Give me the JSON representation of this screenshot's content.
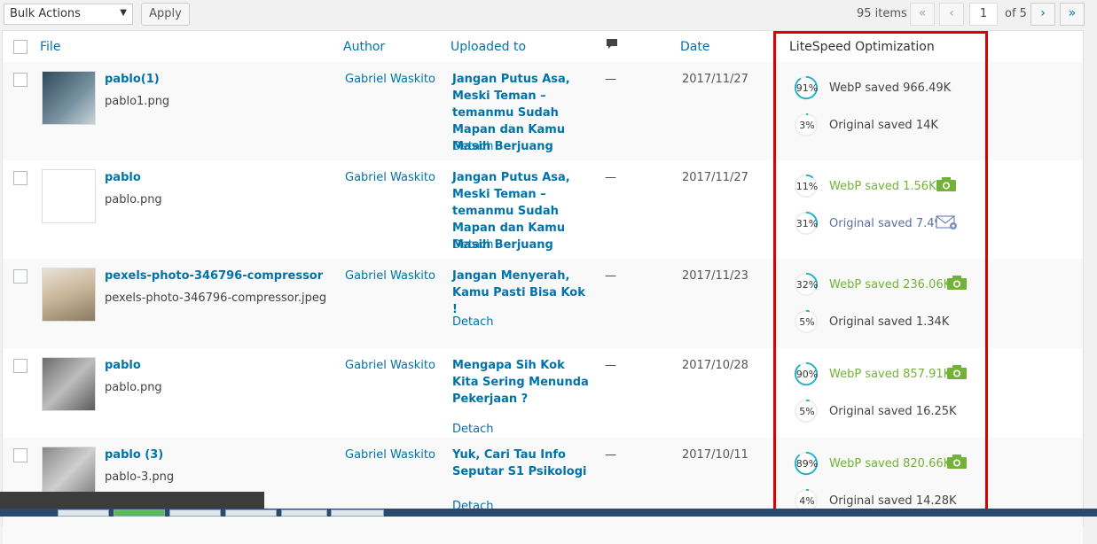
{
  "toolbar": {
    "bulk_actions": "Bulk Actions",
    "apply": "Apply",
    "items_count": "95 items",
    "first": "«",
    "prev": "‹",
    "current_page": "1",
    "of_pages": "of 5",
    "next": "›",
    "last": "»"
  },
  "columns": {
    "file": "File",
    "author": "Author",
    "uploaded_to": "Uploaded to",
    "comments_icon": "comment-icon",
    "date": "Date",
    "litespeed": "LiteSpeed Optimization"
  },
  "rows": [
    {
      "title": "pablo(1)",
      "filename": "pablo1.png",
      "author": "Gabriel Waskito",
      "uploaded_to": "Jangan Putus Asa, Meski Teman – temanmu Sudah Mapan dan Kamu Masih Berjuang",
      "detach": "Detach",
      "comments": "—",
      "date": "2017/11/27",
      "webp_pct": "91%",
      "webp": "WebP saved 966.49K",
      "webp_fill": 0.91,
      "webp_green": false,
      "orig_pct": "3%",
      "orig": "Original saved 14K",
      "orig_fill": 0.03,
      "orig_icon": ""
    },
    {
      "title": "pablo",
      "filename": "pablo.png",
      "author": "Gabriel Waskito",
      "uploaded_to": "Jangan Putus Asa, Meski Teman – temanmu Sudah Mapan dan Kamu Masih Berjuang",
      "detach": "Detach",
      "comments": "—",
      "date": "2017/11/27",
      "webp_pct": "11%",
      "webp": "WebP saved 1.56K",
      "webp_fill": 0.11,
      "webp_green": true,
      "orig_pct": "31%",
      "orig": "Original saved 7.49K",
      "orig_fill": 0.31,
      "orig_icon": "mail-settings-icon"
    },
    {
      "title": "pexels-photo-346796-compressor",
      "filename": "pexels-photo-346796-compressor.jpeg",
      "author": "Gabriel Waskito",
      "uploaded_to": "Jangan Menyerah, Kamu Pasti Bisa Kok !",
      "detach": "Detach",
      "comments": "—",
      "date": "2017/11/23",
      "webp_pct": "32%",
      "webp": "WebP saved 236.06K",
      "webp_fill": 0.32,
      "webp_green": true,
      "orig_pct": "5%",
      "orig": "Original saved 1.34K",
      "orig_fill": 0.05,
      "orig_icon": ""
    },
    {
      "title": "pablo",
      "filename": "pablo.png",
      "author": "Gabriel Waskito",
      "uploaded_to": "Mengapa Sih Kok Kita Sering Menunda Pekerjaan ?",
      "detach": "Detach",
      "comments": "—",
      "date": "2017/10/28",
      "webp_pct": "90%",
      "webp": "WebP saved 857.91K",
      "webp_fill": 0.9,
      "webp_green": true,
      "orig_pct": "5%",
      "orig": "Original saved 16.25K",
      "orig_fill": 0.05,
      "orig_icon": ""
    },
    {
      "title": "pablo (3)",
      "filename": "pablo-3.png",
      "author": "Gabriel Waskito",
      "uploaded_to": "Yuk, Cari Tau Info Seputar S1 Psikologi",
      "detach": "Detach",
      "comments": "—",
      "date": "2017/10/11",
      "webp_pct": "89%",
      "webp": "WebP saved 820.66K",
      "webp_fill": 0.89,
      "webp_green": true,
      "orig_pct": "4%",
      "orig": "Original saved 14.28K",
      "orig_fill": 0.04,
      "orig_icon": ""
    }
  ],
  "colors": {
    "link": "#0073aa",
    "green": "#72b239",
    "ring": "#1bb3c7",
    "highlight": "#dd0000"
  }
}
